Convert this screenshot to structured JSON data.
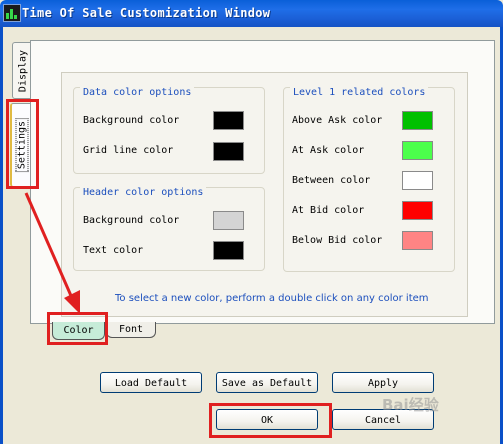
{
  "window": {
    "title": "Time Of Sale Customization Window"
  },
  "side_tabs": [
    {
      "label": "Display"
    },
    {
      "label": "Settings"
    }
  ],
  "data_color_group": {
    "title": "Data color options",
    "items": [
      {
        "label": "Background color",
        "color": "#000000"
      },
      {
        "label": "Grid line color",
        "color": "#000000"
      }
    ]
  },
  "header_color_group": {
    "title": "Header color options",
    "items": [
      {
        "label": "Background color",
        "color": "#d4d4d4"
      },
      {
        "label": "Text color",
        "color": "#000000"
      }
    ]
  },
  "level1_group": {
    "title": "Level 1 related colors",
    "items": [
      {
        "label": "Above Ask color",
        "color": "#00c000"
      },
      {
        "label": "At Ask color",
        "color": "#4cff4c"
      },
      {
        "label": "Between color",
        "color": "#ffffff"
      },
      {
        "label": "At Bid color",
        "color": "#ff0000"
      },
      {
        "label": "Below Bid color",
        "color": "#ff8484"
      }
    ]
  },
  "hint_text": "To select a new color, perform a double click on any color item",
  "bottom_tabs": [
    {
      "label": "Color"
    },
    {
      "label": "Font"
    }
  ],
  "buttons": {
    "load_default": "Load Default",
    "save_as_default": "Save as Default",
    "apply": "Apply",
    "ok": "OK",
    "cancel": "Cancel"
  },
  "watermark": "Bai经验"
}
